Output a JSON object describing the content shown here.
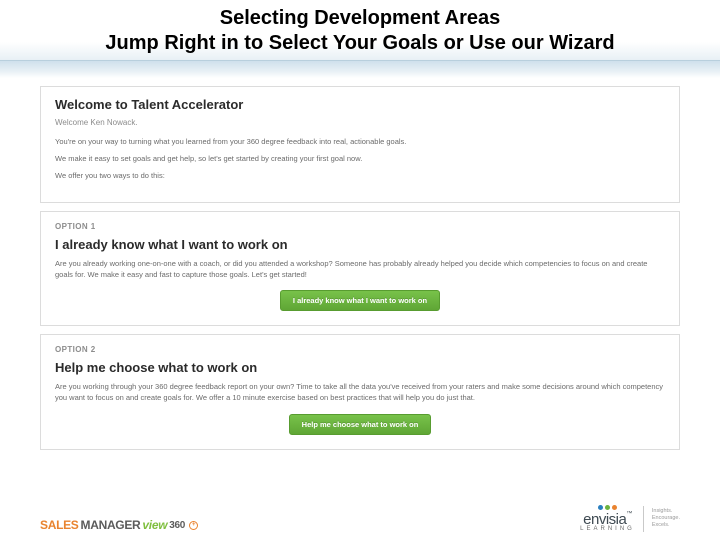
{
  "header": {
    "title_line1": "Selecting Development Areas",
    "title_line2": "Jump Right in to Select Your Goals or Use our Wizard"
  },
  "welcome": {
    "title": "Welcome to Talent Accelerator",
    "greeting": "Welcome Ken Nowack.",
    "p1": "You're on your way to turning what you learned from your 360 degree feedback into real, actionable goals.",
    "p2": "We make it easy to set goals and get help, so let's get started by creating your first goal now.",
    "p3": "We offer you two ways to do this:"
  },
  "option1": {
    "label": "OPTION 1",
    "title": "I already know what I want to work on",
    "body": "Are you already working one-on-one with a coach, or did you attended a workshop? Someone has probably already helped you decide which competencies to focus on and create goals for. We make it easy and fast to capture those goals. Let's get started!",
    "button": "I already know what I want to work on"
  },
  "option2": {
    "label": "OPTION 2",
    "title": "Help me choose what to work on",
    "body": "Are you working through your 360 degree feedback report on your own? Time to take all the data you've received from your raters and make some decisions around which competency you want to focus on and create goals for. We offer a 10 minute exercise based on best practices that will help you do just that.",
    "button": "Help me choose what to work on"
  },
  "footer": {
    "sales_logo": {
      "sales": "SALES ",
      "manager": "MANAGER",
      "view": "view",
      "num": "360"
    },
    "envisia": {
      "name": "envisia",
      "sub": "LEARNING",
      "tag1": "Insights.",
      "tag2": "Encourage.",
      "tag3": "Excels."
    }
  }
}
